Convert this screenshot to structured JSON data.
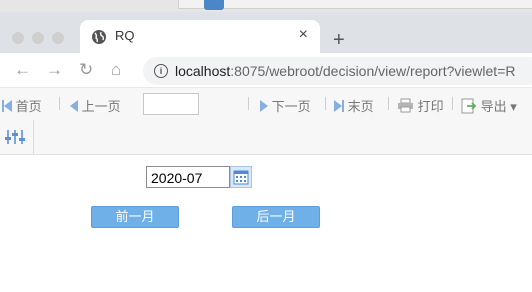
{
  "browser": {
    "tab_title": "RQ",
    "tab_close": "×",
    "new_tab": "+",
    "url_host": "localhost",
    "url_rest": ":8075/webroot/decision/view/report?viewlet=R",
    "nav_back": "←",
    "nav_forward": "→",
    "nav_reload": "↻",
    "nav_home": "⌂",
    "info": "i"
  },
  "report_toolbar": {
    "first_page": "首页",
    "prev_page": "上一页",
    "page_value": "",
    "next_page": "下一页",
    "last_page": "末页",
    "print": "打印",
    "export": "导出",
    "export_arrow": "▾"
  },
  "form": {
    "date_value": "2020-07",
    "prev_month": "前一月",
    "next_month": "后一月"
  },
  "colors": {
    "accent_blue": "#6fb0e8",
    "icon_blue": "#88aedf"
  }
}
